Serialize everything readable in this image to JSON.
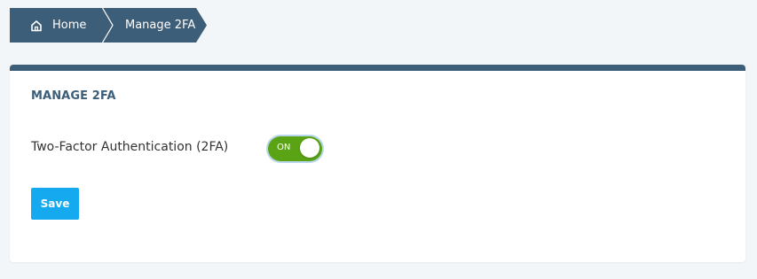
{
  "breadcrumb": {
    "home_label": "Home",
    "current_label": "Manage 2FA"
  },
  "card": {
    "title": "MANAGE 2FA",
    "setting_label": "Two-Factor Authentication (2FA)",
    "toggle_state_text": "ON",
    "toggle_on": true,
    "save_label": "Save"
  },
  "colors": {
    "header_navy": "#3d5e78",
    "toggle_green": "#5aa315",
    "save_blue": "#15a9f0",
    "page_bg": "#f3f6f8"
  },
  "icons": {
    "home": "home-icon"
  }
}
